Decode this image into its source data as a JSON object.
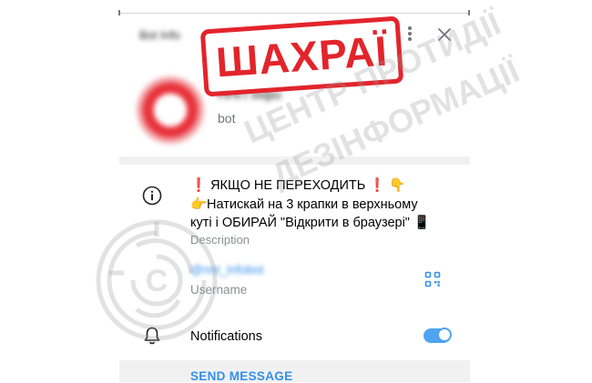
{
  "header": {
    "title": "Bot Info",
    "menu_icon": "more-vertical-icon",
    "close_icon": "close-icon"
  },
  "stamp": {
    "text": "ШАХРАЇ",
    "color": "#e3242b"
  },
  "profile": {
    "name": "ННП Інфо",
    "subtitle": "bot"
  },
  "description": {
    "lines": [
      "❗️ ЯКЩО НЕ ПЕРЕХОДИТЬ ❗️ 👇",
      "👉Натискай на 3 крапки в верхньому",
      "куті і ОБИРАЙ \"Відкрити в браузері\" 📱"
    ],
    "label": "Description"
  },
  "username": {
    "value": "@nnt_infobot",
    "label": "Username",
    "qr_icon": "qr-code-icon"
  },
  "notifications": {
    "label": "Notifications",
    "enabled": true,
    "icon": "bell-icon"
  },
  "actions": {
    "send_message": "SEND MESSAGE"
  },
  "watermark": {
    "line1": "ЦЕНТР ПРОТИДІЇ",
    "line2": "ДЕЗІНФОРМАЦІЇ"
  },
  "colors": {
    "accent": "#3390ec",
    "stamp": "#e3242b",
    "toggle": "#4fa3f0",
    "muted": "#8a8f93"
  }
}
